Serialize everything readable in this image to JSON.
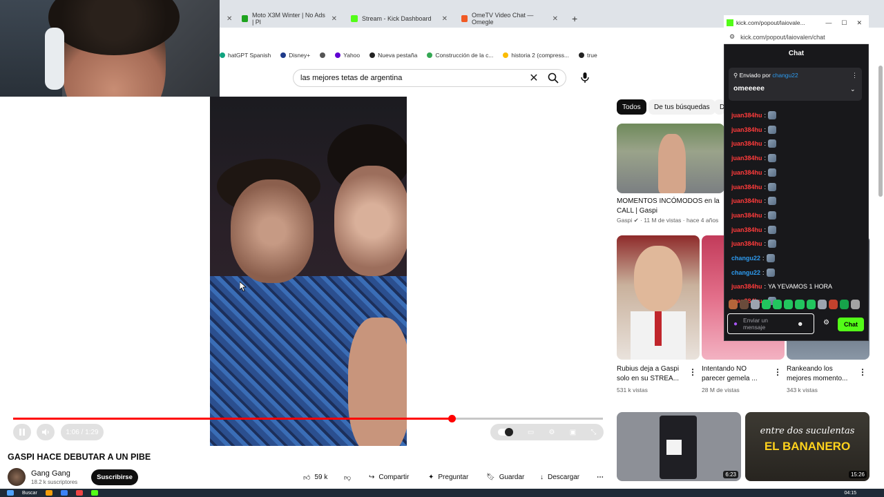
{
  "browser": {
    "tabs": [
      {
        "label": "Moto X3M Winter | No Ads | Pl",
        "color": "#1ea31e"
      },
      {
        "label": "Stream - Kick Dashboard",
        "color": "#53fc18"
      },
      {
        "label": "OmeTV Video Chat — Omegle",
        "color": "#f15a24"
      }
    ],
    "new_tab": "+",
    "bookmarks": [
      {
        "label": "hatGPT Spanish",
        "color": "#10a37f"
      },
      {
        "label": "Disney+",
        "color": "#1e3a8a"
      },
      {
        "label": "",
        "color": "#555555"
      },
      {
        "label": "Yahoo",
        "color": "#6001d2"
      },
      {
        "label": "Nueva pestaña",
        "color": "#222222"
      },
      {
        "label": "Construcción de la c...",
        "color": "#34a853"
      },
      {
        "label": "historia 2 (compress...",
        "color": "#fbbc04"
      },
      {
        "label": "true",
        "color": "#222222"
      }
    ]
  },
  "search": {
    "query": "las mejores tetas de argentina"
  },
  "player": {
    "progress": 0.744,
    "time": "1:06 / 1:29"
  },
  "video": {
    "title": "GASPI HACE DEBUTAR A UN PIBE",
    "channel": "Gang Gang",
    "subscribers": "18.2 k suscriptores",
    "subscribe_label": "Suscribirse",
    "likes": "59 k",
    "share_label": "Compartir",
    "ask_label": "Preguntar",
    "save_label": "Guardar",
    "download_label": "Descargar"
  },
  "chips": [
    "Todos",
    "De tus búsquedas",
    "D"
  ],
  "recommendations": {
    "top": {
      "title": "MOMENTOS INCÓMODOS en la CALL | Gaspi",
      "channel": "Gaspi",
      "meta": "11 M de vistas · hace 4 años"
    },
    "row": [
      {
        "title": "Rubius deja a Gaspi solo en su STREA...",
        "meta": "531 k vistas"
      },
      {
        "title": "Intentando NO parecer gemela ...",
        "meta": "28 M de vistas"
      },
      {
        "title": "Rankeando los mejores momento...",
        "meta": "343 k vistas"
      }
    ],
    "bottom": [
      {
        "duration": "6:23"
      },
      {
        "duration": "15:26",
        "overlay_text": "entre dos suculentas",
        "overlay_big": "EL BANANERO"
      }
    ]
  },
  "chat": {
    "window_title": "kick.com/popout/laiovale...",
    "url": "kick.com/popout/laiovalen/chat",
    "header": "Chat",
    "pinned_prefix": "Enviado por",
    "pinned_user": "changu22",
    "pinned_message": "omeeeee",
    "messages": [
      {
        "user": "juan384hu",
        "color": "#ff3b3b",
        "text": ""
      },
      {
        "user": "juan384hu",
        "color": "#ff3b3b",
        "text": ""
      },
      {
        "user": "juan384hu",
        "color": "#ff3b3b",
        "text": ""
      },
      {
        "user": "juan384hu",
        "color": "#ff3b3b",
        "text": ""
      },
      {
        "user": "juan384hu",
        "color": "#ff3b3b",
        "text": ""
      },
      {
        "user": "juan384hu",
        "color": "#ff3b3b",
        "text": ""
      },
      {
        "user": "juan384hu",
        "color": "#ff3b3b",
        "text": ""
      },
      {
        "user": "juan384hu",
        "color": "#ff3b3b",
        "text": ""
      },
      {
        "user": "juan384hu",
        "color": "#ff3b3b",
        "text": ""
      },
      {
        "user": "juan384hu",
        "color": "#ff3b3b",
        "text": ""
      },
      {
        "user": "changu22",
        "color": "#2d9bf0",
        "text": ""
      },
      {
        "user": "changu22",
        "color": "#2d9bf0",
        "text": ""
      },
      {
        "user": "juan384hu",
        "color": "#ff3b3b",
        "text": "YA YEVAMOS 1 HORA"
      },
      {
        "user": "juan384hu",
        "color": "#ff3b3b",
        "text": ""
      }
    ],
    "input_placeholder": "Enviar un mensaje",
    "send_label": "Chat"
  },
  "taskbar": {
    "search_placeholder": "Buscar",
    "clock": "04:15"
  },
  "colors": {
    "accent": "#ff0000",
    "kick_green": "#53fc18"
  }
}
